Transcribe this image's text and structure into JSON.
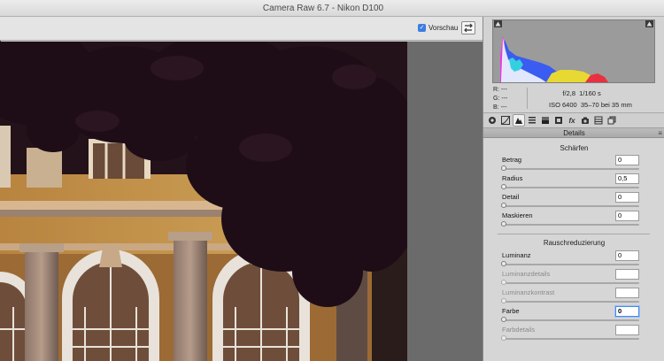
{
  "window": {
    "title": "Camera Raw 6.7 - Nikon D100"
  },
  "toolbar": {
    "preview_label": "Vorschau"
  },
  "info": {
    "r_label": "R:",
    "r_value": "---",
    "g_label": "G:",
    "g_value": "---",
    "b_label": "B:",
    "b_value": "---",
    "aperture": "f/2,8",
    "shutter": "1/160 s",
    "iso": "ISO 6400",
    "lens": "35–70 bei 35 mm"
  },
  "tabs": [
    {
      "icon": "aperture-icon"
    },
    {
      "icon": "tone-curve-icon"
    },
    {
      "icon": "detail-icon"
    },
    {
      "icon": "hsl-icon"
    },
    {
      "icon": "split-tone-icon"
    },
    {
      "icon": "lens-icon"
    },
    {
      "icon": "fx-icon"
    },
    {
      "icon": "camera-calibration-icon"
    },
    {
      "icon": "presets-icon"
    },
    {
      "icon": "snapshots-icon"
    }
  ],
  "panel": {
    "title": "Details",
    "sharpen": {
      "title": "Schärfen",
      "controls": [
        {
          "label": "Betrag",
          "value": "0",
          "level": 0
        },
        {
          "label": "Radius",
          "value": "0,5",
          "level": 0
        },
        {
          "label": "Detail",
          "value": "0",
          "level": 0
        },
        {
          "label": "Maskieren",
          "value": "0",
          "level": 0
        }
      ]
    },
    "noise": {
      "title": "Rauschreduzierung",
      "controls": [
        {
          "label": "Luminanz",
          "value": "0",
          "level": 0
        },
        {
          "label": "Luminanzdetails",
          "value": "",
          "level": 0
        },
        {
          "label": "Luminanzkontrast",
          "value": "",
          "level": 0
        },
        {
          "label": "Farbe",
          "value": "0",
          "level": 0
        },
        {
          "label": "Farbdetails",
          "value": "",
          "level": 0
        }
      ]
    }
  }
}
